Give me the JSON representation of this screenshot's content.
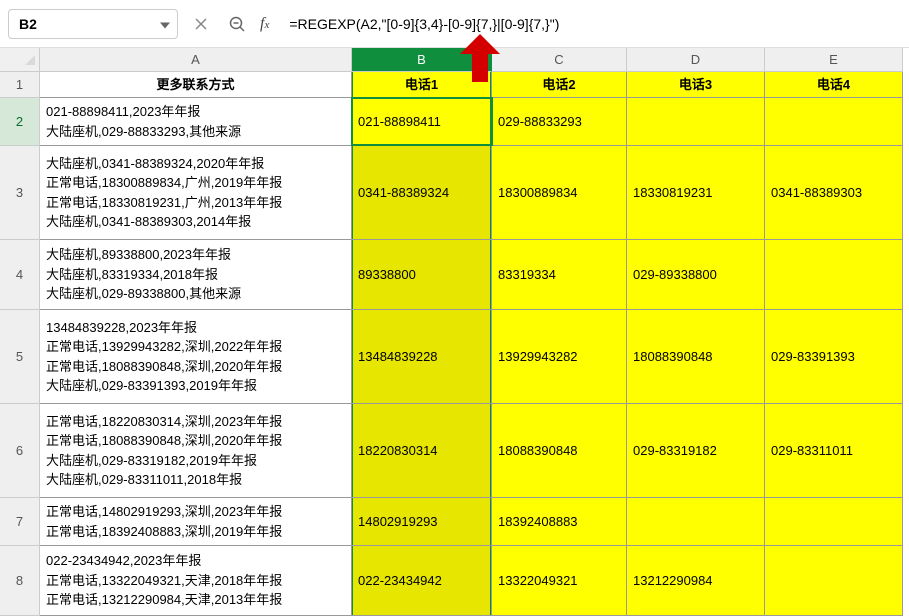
{
  "namebox": "B2",
  "formula": "=REGEXP(A2,\"[0-9]{3,4}-[0-9]{7,}|[0-9]{7,}\")",
  "colHeaders": [
    "A",
    "B",
    "C",
    "D",
    "E"
  ],
  "rowHeaders": [
    "1",
    "2",
    "3",
    "4",
    "5",
    "6",
    "7",
    "8"
  ],
  "header": {
    "A": "更多联系方式",
    "B": "电话1",
    "C": "电话2",
    "D": "电话3",
    "E": "电话4"
  },
  "rows": [
    {
      "A": "021-88898411,2023年年报\n大陆座机,029-88833293,其他来源",
      "B": "021-88898411",
      "C": "029-88833293",
      "D": "",
      "E": ""
    },
    {
      "A": "大陆座机,0341-88389324,2020年年报\n正常电话,18300889834,广州,2019年年报\n正常电话,18330819231,广州,2013年年报\n大陆座机,0341-88389303,2014年报",
      "B": "0341-88389324",
      "C": "18300889834",
      "D": "18330819231",
      "E": "0341-88389303"
    },
    {
      "A": "大陆座机,89338800,2023年年报\n大陆座机,83319334,2018年报\n大陆座机,029-89338800,其他来源",
      "B": "89338800",
      "C": "83319334",
      "D": "029-89338800",
      "E": ""
    },
    {
      "A": "13484839228,2023年年报\n正常电话,13929943282,深圳,2022年年报\n正常电话,18088390848,深圳,2020年年报\n大陆座机,029-83391393,2019年年报",
      "B": "13484839228",
      "C": "13929943282",
      "D": "18088390848",
      "E": "029-83391393"
    },
    {
      "A": "正常电话,18220830314,深圳,2023年年报\n正常电话,18088390848,深圳,2020年年报\n大陆座机,029-83319182,2019年年报\n大陆座机,029-83311011,2018年报",
      "B": "18220830314",
      "C": "18088390848",
      "D": "029-83319182",
      "E": "029-83311011"
    },
    {
      "A": "正常电话,14802919293,深圳,2023年年报\n正常电话,18392408883,深圳,2019年年报",
      "B": "14802919293",
      "C": "18392408883",
      "D": "",
      "E": ""
    },
    {
      "A": "022-23434942,2023年年报\n正常电话,13322049321,天津,2018年年报\n正常电话,13212290984,天津,2013年年报",
      "B": "022-23434942",
      "C": "13322049321",
      "D": "13212290984",
      "E": ""
    }
  ],
  "chart_data": {
    "type": "table",
    "title": "REGEXP 提取电话号码示例",
    "columns": [
      "更多联系方式",
      "电话1",
      "电话2",
      "电话3",
      "电话4"
    ],
    "rows": [
      [
        "021-88898411,2023年年报 / 大陆座机,029-88833293,其他来源",
        "021-88898411",
        "029-88833293",
        "",
        ""
      ],
      [
        "大陆座机,0341-88389324,2020年年报 / 正常电话,18300889834,广州,2019年年报 / 正常电话,18330819231,广州,2013年年报 / 大陆座机,0341-88389303,2014年报",
        "0341-88389324",
        "18300889834",
        "18330819231",
        "0341-88389303"
      ],
      [
        "大陆座机,89338800,2023年年报 / 大陆座机,83319334,2018年报 / 大陆座机,029-89338800,其他来源",
        "89338800",
        "83319334",
        "029-89338800",
        ""
      ],
      [
        "13484839228,2023年年报 / 正常电话,13929943282,深圳,2022年年报 / 正常电话,18088390848,深圳,2020年年报 / 大陆座机,029-83391393,2019年年报",
        "13484839228",
        "13929943282",
        "18088390848",
        "029-83391393"
      ],
      [
        "正常电话,18220830314,深圳,2023年年报 / 正常电话,18088390848,深圳,2020年年报 / 大陆座机,029-83319182,2019年年报 / 大陆座机,029-83311011,2018年报",
        "18220830314",
        "18088390848",
        "029-83319182",
        "029-83311011"
      ],
      [
        "正常电话,14802919293,深圳,2023年年报 / 正常电话,18392408883,深圳,2019年年报",
        "14802919293",
        "18392408883",
        "",
        ""
      ],
      [
        "022-23434942,2023年年报 / 正常电话,13322049321,天津,2018年年报 / 正常电话,13212290984,天津,2013年年报",
        "022-23434942",
        "13322049321",
        "13212290984",
        ""
      ]
    ]
  }
}
